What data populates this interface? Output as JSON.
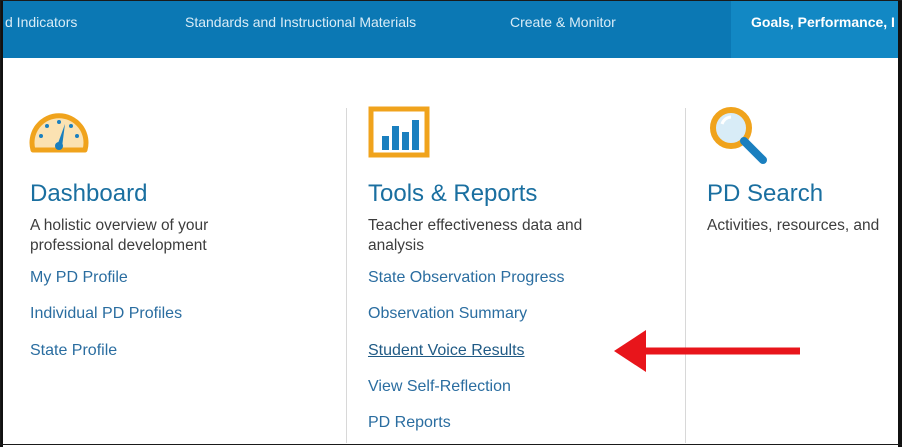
{
  "nav": {
    "items": [
      "d Indicators",
      "Standards and Instructional Materials",
      "Create & Monitor"
    ],
    "active": "Goals, Performance, I"
  },
  "columns": [
    {
      "icon": "speedometer-icon",
      "title": "Dashboard",
      "desc_line1": "A holistic overview of your",
      "desc_line2": "professional development",
      "links": [
        "My PD Profile",
        "Individual PD Profiles",
        "State Profile"
      ]
    },
    {
      "icon": "bar-chart-icon",
      "title": "Tools & Reports",
      "desc_line1": "Teacher effectiveness data and",
      "desc_line2": "analysis",
      "links": [
        "State Observation Progress",
        "Observation Summary",
        "Student Voice Results",
        "View Self-Reflection",
        "PD Reports"
      ]
    },
    {
      "icon": "magnifier-icon",
      "title": "PD Search",
      "desc_line1": "Activities, resources, and"
    }
  ],
  "colors": {
    "nav_bg": "#0b78b4",
    "nav_active_bg": "#1288c4",
    "icon_orange": "#f0a31c",
    "icon_blue": "#1a7fbf",
    "arrow": "#e8151b"
  }
}
